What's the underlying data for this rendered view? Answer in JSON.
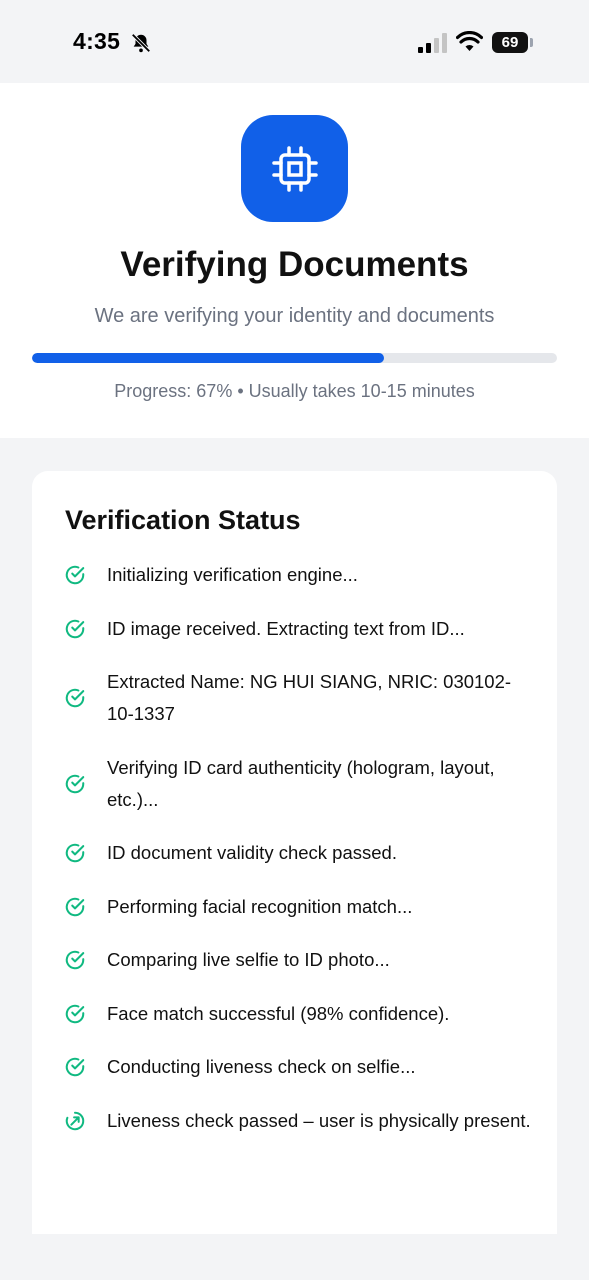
{
  "status_bar": {
    "time": "4:35",
    "battery": "69"
  },
  "header": {
    "icon": "cpu-chip-icon",
    "title": "Verifying Documents",
    "subtitle": "We are verifying your identity and documents",
    "progress": 0.67,
    "progress_text": "Progress: 67% • Usually takes 10-15 minutes"
  },
  "status": {
    "title": "Verification Status",
    "steps": [
      {
        "text": "Initializing verification engine...",
        "state": "done"
      },
      {
        "text": "ID image received. Extracting text from ID...",
        "state": "done"
      },
      {
        "text": "Extracted Name: NG HUI SIANG, NRIC: 030102-10-1337",
        "state": "done"
      },
      {
        "text": "Verifying ID card authenticity (hologram, layout, etc.)...",
        "state": "done"
      },
      {
        "text": "ID document validity check passed.",
        "state": "done"
      },
      {
        "text": "Performing facial recognition match...",
        "state": "done"
      },
      {
        "text": "Comparing live selfie to ID photo...",
        "state": "done"
      },
      {
        "text": "Face match successful (98% confidence).",
        "state": "done"
      },
      {
        "text": "Conducting liveness check on selfie...",
        "state": "done"
      },
      {
        "text": "Liveness check passed – user is physically present.",
        "state": "in-progress"
      }
    ]
  },
  "colors": {
    "accent": "#1160e8",
    "success": "#10b981",
    "muted": "#6b7280"
  }
}
